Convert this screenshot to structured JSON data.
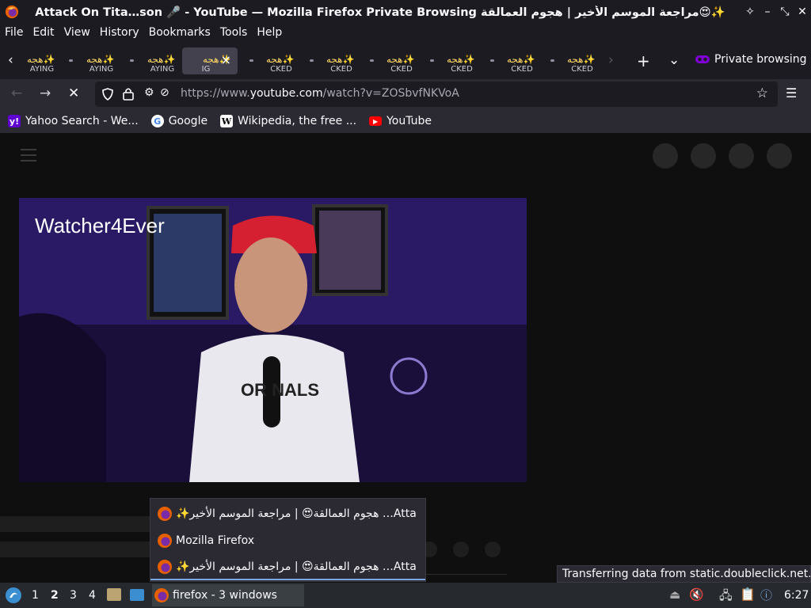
{
  "window": {
    "title": "Attack On Tita…son 🎤 - YouTube — Mozilla Firefox Private Browsing مراجعة الموسم الأخير | هجوم العمالقة😍✨"
  },
  "menu": [
    "File",
    "Edit",
    "View",
    "History",
    "Bookmarks",
    "Tools",
    "Help"
  ],
  "tabs": [
    {
      "label": "AYING",
      "active": false
    },
    {
      "label": "AYING",
      "active": false
    },
    {
      "label": "AYING",
      "active": false
    },
    {
      "label": "IG",
      "active": true
    },
    {
      "label": "CKED",
      "active": false
    },
    {
      "label": "CKED",
      "active": false
    },
    {
      "label": "CKED",
      "active": false
    },
    {
      "label": "CKED",
      "active": false
    },
    {
      "label": "CKED",
      "active": false
    },
    {
      "label": "CKED",
      "active": false
    }
  ],
  "tab_prefix": "هجه✨",
  "private_browsing_label": "Private browsing",
  "url": {
    "prefix": "https://www.",
    "domain": "youtube.com",
    "path": "/watch?v=ZOSbvfNKVoA"
  },
  "bookmarks": [
    {
      "label": "Yahoo Search - We...",
      "icon": "yahoo-icon",
      "color": "#5f01d1"
    },
    {
      "label": "Google",
      "icon": "google-icon",
      "color": "#ffffff"
    },
    {
      "label": "Wikipedia, the free ...",
      "icon": "wikipedia-icon",
      "color": "#ffffff"
    },
    {
      "label": "YouTube",
      "icon": "youtube-icon",
      "color": "#ff0000"
    }
  ],
  "video": {
    "watermark": "Watcher4Ever"
  },
  "popup": {
    "items": [
      "Atta… هجوم العمالقة😍 | مراجعة الموسم الأخير✨",
      "Mozilla Firefox",
      "Atta… هجوم العمالقة😍 | مراجعة الموسم الأخير✨"
    ]
  },
  "status_text": "Transferring data from static.doubleclick.net...",
  "taskbar": {
    "workspaces": [
      "1",
      "2",
      "3",
      "4"
    ],
    "active_workspace": "2",
    "task_label": "firefox - 3 windows",
    "clock": "6:27"
  },
  "colors": {
    "accent": "#8000d7",
    "youtube_red": "#ff0000"
  }
}
